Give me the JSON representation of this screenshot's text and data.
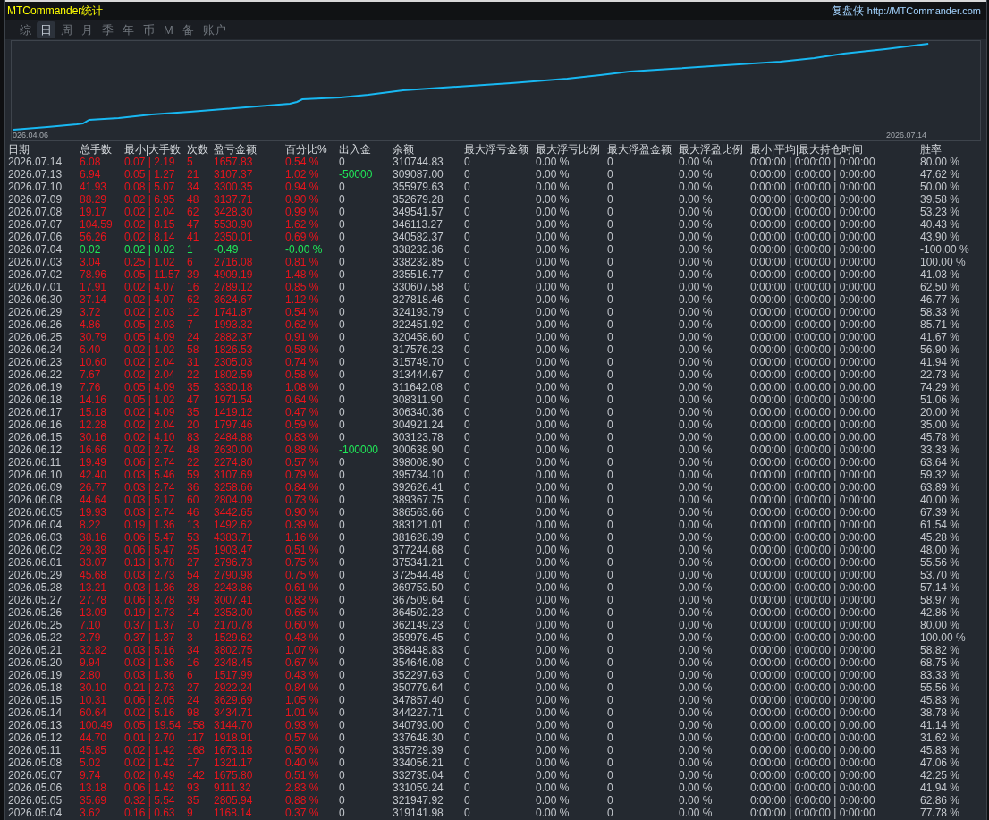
{
  "window": {
    "title": "MTCommander统计",
    "brand": "复盘侠",
    "url": "http://MTCommander.com"
  },
  "tabs": [
    {
      "label": "综",
      "selected": false
    },
    {
      "label": "日",
      "selected": true
    },
    {
      "label": "周",
      "selected": false
    },
    {
      "label": "月",
      "selected": false
    },
    {
      "label": "季",
      "selected": false
    },
    {
      "label": "年",
      "selected": false
    },
    {
      "label": "币",
      "selected": false
    },
    {
      "label": "M",
      "selected": false
    },
    {
      "label": "备",
      "selected": false
    },
    {
      "label": "账户",
      "selected": false
    }
  ],
  "chart": {
    "x_start_label": "026.04.06",
    "x_end_label": "2026.07.14"
  },
  "table": {
    "columns": [
      "日期",
      "总手数",
      "最小|大手数",
      "次数",
      "盈亏金额",
      "百分比%",
      "出入金",
      "余额",
      "最大浮亏金额",
      "最大浮亏比例",
      "最大浮盈金额",
      "最大浮盈比例",
      "最小|平均|最大持仓时间",
      "胜率"
    ],
    "rows": [
      {
        "cells": [
          "2026.07.14",
          "6.08",
          "0.07 | 2.19",
          "5",
          "1657.83",
          "0.54 %",
          "0",
          "310744.83",
          "0",
          "0.00 %",
          "0",
          "0.00 %",
          "0:00:00 | 0:00:00 | 0:00:00",
          "80.00 %"
        ],
        "color": "#e8141c",
        "transfer": {
          "color": "#c3c7cc"
        }
      },
      {
        "cells": [
          "2026.07.13",
          "6.94",
          "0.05 | 1.27",
          "21",
          "3107.37",
          "1.02 %",
          "-50000",
          "309087.00",
          "0",
          "0.00 %",
          "0",
          "0.00 %",
          "0:00:00 | 0:00:00 | 0:00:00",
          "47.62 %"
        ],
        "color": "#e8141c",
        "transfer": {
          "color": "#20e858"
        }
      },
      {
        "cells": [
          "2026.07.10",
          "41.93",
          "0.08 | 5.07",
          "34",
          "3300.35",
          "0.94 %",
          "0",
          "355979.63",
          "0",
          "0.00 %",
          "0",
          "0.00 %",
          "0:00:00 | 0:00:00 | 0:00:00",
          "50.00 %"
        ],
        "color": "#e8141c",
        "transfer": {
          "color": "#c3c7cc"
        }
      },
      {
        "cells": [
          "2026.07.09",
          "88.29",
          "0.02 | 6.95",
          "48",
          "3137.71",
          "0.90 %",
          "0",
          "352679.28",
          "0",
          "0.00 %",
          "0",
          "0.00 %",
          "0:00:00 | 0:00:00 | 0:00:00",
          "39.58 %"
        ],
        "color": "#e8141c",
        "transfer": {
          "color": "#c3c7cc"
        }
      },
      {
        "cells": [
          "2026.07.08",
          "19.17",
          "0.02 | 2.04",
          "62",
          "3428.30",
          "0.99 %",
          "0",
          "349541.57",
          "0",
          "0.00 %",
          "0",
          "0.00 %",
          "0:00:00 | 0:00:00 | 0:00:00",
          "53.23 %"
        ],
        "color": "#e8141c",
        "transfer": {
          "color": "#c3c7cc"
        }
      },
      {
        "cells": [
          "2026.07.07",
          "104.59",
          "0.02 | 8.15",
          "47",
          "5530.90",
          "1.62 %",
          "0",
          "346113.27",
          "0",
          "0.00 %",
          "0",
          "0.00 %",
          "0:00:00 | 0:00:00 | 0:00:00",
          "40.43 %"
        ],
        "color": "#e8141c",
        "transfer": {
          "color": "#c3c7cc"
        }
      },
      {
        "cells": [
          "2026.07.06",
          "56.26",
          "0.02 | 8.14",
          "41",
          "2350.01",
          "0.69 %",
          "0",
          "340582.37",
          "0",
          "0.00 %",
          "0",
          "0.00 %",
          "0:00:00 | 0:00:00 | 0:00:00",
          "43.90 %"
        ],
        "color": "#e8141c",
        "transfer": {
          "color": "#c3c7cc"
        }
      },
      {
        "cells": [
          "2026.07.04",
          "0.02",
          "0.02 | 0.02",
          "1",
          "-0.49",
          "-0.00 %",
          "0",
          "338232.36",
          "0",
          "0.00 %",
          "0",
          "0.00 %",
          "0:00:00 | 0:00:00 | 0:00:00",
          "-100.00 %"
        ],
        "color": "#20e858",
        "transfer": {
          "color": "#c3c7cc"
        }
      },
      {
        "cells": [
          "2026.07.03",
          "3.04",
          "0.25 | 1.02",
          "6",
          "2716.08",
          "0.81 %",
          "0",
          "338232.85",
          "0",
          "0.00 %",
          "0",
          "0.00 %",
          "0:00:00 | 0:00:00 | 0:00:00",
          "100.00 %"
        ],
        "color": "#e8141c",
        "transfer": {
          "color": "#c3c7cc"
        }
      },
      {
        "cells": [
          "2026.07.02",
          "78.96",
          "0.05 | 11.57",
          "39",
          "4909.19",
          "1.48 %",
          "0",
          "335516.77",
          "0",
          "0.00 %",
          "0",
          "0.00 %",
          "0:00:00 | 0:00:00 | 0:00:00",
          "41.03 %"
        ],
        "color": "#e8141c",
        "transfer": {
          "color": "#c3c7cc"
        }
      },
      {
        "cells": [
          "2026.07.01",
          "17.91",
          "0.02 | 4.07",
          "16",
          "2789.12",
          "0.85 %",
          "0",
          "330607.58",
          "0",
          "0.00 %",
          "0",
          "0.00 %",
          "0:00:00 | 0:00:00 | 0:00:00",
          "62.50 %"
        ],
        "color": "#e8141c",
        "transfer": {
          "color": "#c3c7cc"
        }
      },
      {
        "cells": [
          "2026.06.30",
          "37.14",
          "0.02 | 4.07",
          "62",
          "3624.67",
          "1.12 %",
          "0",
          "327818.46",
          "0",
          "0.00 %",
          "0",
          "0.00 %",
          "0:00:00 | 0:00:00 | 0:00:00",
          "46.77 %"
        ],
        "color": "#e8141c",
        "transfer": {
          "color": "#c3c7cc"
        }
      },
      {
        "cells": [
          "2026.06.29",
          "3.72",
          "0.02 | 2.03",
          "12",
          "1741.87",
          "0.54 %",
          "0",
          "324193.79",
          "0",
          "0.00 %",
          "0",
          "0.00 %",
          "0:00:00 | 0:00:00 | 0:00:00",
          "58.33 %"
        ],
        "color": "#e8141c",
        "transfer": {
          "color": "#c3c7cc"
        }
      },
      {
        "cells": [
          "2026.06.26",
          "4.86",
          "0.05 | 2.03",
          "7",
          "1993.32",
          "0.62 %",
          "0",
          "322451.92",
          "0",
          "0.00 %",
          "0",
          "0.00 %",
          "0:00:00 | 0:00:00 | 0:00:00",
          "85.71 %"
        ],
        "color": "#e8141c",
        "transfer": {
          "color": "#c3c7cc"
        }
      },
      {
        "cells": [
          "2026.06.25",
          "30.79",
          "0.05 | 4.09",
          "24",
          "2882.37",
          "0.91 %",
          "0",
          "320458.60",
          "0",
          "0.00 %",
          "0",
          "0.00 %",
          "0:00:00 | 0:00:00 | 0:00:00",
          "41.67 %"
        ],
        "color": "#e8141c",
        "transfer": {
          "color": "#c3c7cc"
        }
      },
      {
        "cells": [
          "2026.06.24",
          "6.40",
          "0.02 | 1.02",
          "58",
          "1826.53",
          "0.58 %",
          "0",
          "317576.23",
          "0",
          "0.00 %",
          "0",
          "0.00 %",
          "0:00:00 | 0:00:00 | 0:00:00",
          "56.90 %"
        ],
        "color": "#e8141c",
        "transfer": {
          "color": "#c3c7cc"
        }
      },
      {
        "cells": [
          "2026.06.23",
          "10.60",
          "0.02 | 2.04",
          "31",
          "2305.03",
          "0.74 %",
          "0",
          "315749.70",
          "0",
          "0.00 %",
          "0",
          "0.00 %",
          "0:00:00 | 0:00:00 | 0:00:00",
          "41.94 %"
        ],
        "color": "#e8141c",
        "transfer": {
          "color": "#c3c7cc"
        }
      },
      {
        "cells": [
          "2026.06.22",
          "7.67",
          "0.02 | 2.04",
          "22",
          "1802.59",
          "0.58 %",
          "0",
          "313444.67",
          "0",
          "0.00 %",
          "0",
          "0.00 %",
          "0:00:00 | 0:00:00 | 0:00:00",
          "22.73 %"
        ],
        "color": "#e8141c",
        "transfer": {
          "color": "#c3c7cc"
        }
      },
      {
        "cells": [
          "2026.06.19",
          "7.76",
          "0.05 | 4.09",
          "35",
          "3330.18",
          "1.08 %",
          "0",
          "311642.08",
          "0",
          "0.00 %",
          "0",
          "0.00 %",
          "0:00:00 | 0:00:00 | 0:00:00",
          "74.29 %"
        ],
        "color": "#e8141c",
        "transfer": {
          "color": "#c3c7cc"
        }
      },
      {
        "cells": [
          "2026.06.18",
          "14.16",
          "0.05 | 1.02",
          "47",
          "1971.54",
          "0.64 %",
          "0",
          "308311.90",
          "0",
          "0.00 %",
          "0",
          "0.00 %",
          "0:00:00 | 0:00:00 | 0:00:00",
          "51.06 %"
        ],
        "color": "#e8141c",
        "transfer": {
          "color": "#c3c7cc"
        }
      },
      {
        "cells": [
          "2026.06.17",
          "15.18",
          "0.02 | 4.09",
          "35",
          "1419.12",
          "0.47 %",
          "0",
          "306340.36",
          "0",
          "0.00 %",
          "0",
          "0.00 %",
          "0:00:00 | 0:00:00 | 0:00:00",
          "20.00 %"
        ],
        "color": "#e8141c",
        "transfer": {
          "color": "#c3c7cc"
        }
      },
      {
        "cells": [
          "2026.06.16",
          "12.28",
          "0.02 | 2.04",
          "20",
          "1797.46",
          "0.59 %",
          "0",
          "304921.24",
          "0",
          "0.00 %",
          "0",
          "0.00 %",
          "0:00:00 | 0:00:00 | 0:00:00",
          "35.00 %"
        ],
        "color": "#e8141c",
        "transfer": {
          "color": "#c3c7cc"
        }
      },
      {
        "cells": [
          "2026.06.15",
          "30.16",
          "0.02 | 4.10",
          "83",
          "2484.88",
          "0.83 %",
          "0",
          "303123.78",
          "0",
          "0.00 %",
          "0",
          "0.00 %",
          "0:00:00 | 0:00:00 | 0:00:00",
          "45.78 %"
        ],
        "color": "#e8141c",
        "transfer": {
          "color": "#c3c7cc"
        }
      },
      {
        "cells": [
          "2026.06.12",
          "16.66",
          "0.02 | 2.74",
          "48",
          "2630.00",
          "0.88 %",
          "-100000",
          "300638.90",
          "0",
          "0.00 %",
          "0",
          "0.00 %",
          "0:00:00 | 0:00:00 | 0:00:00",
          "33.33 %"
        ],
        "color": "#e8141c",
        "transfer": {
          "color": "#20e858"
        }
      },
      {
        "cells": [
          "2026.06.11",
          "19.49",
          "0.06 | 2.74",
          "22",
          "2274.80",
          "0.57 %",
          "0",
          "398008.90",
          "0",
          "0.00 %",
          "0",
          "0.00 %",
          "0:00:00 | 0:00:00 | 0:00:00",
          "63.64 %"
        ],
        "color": "#e8141c",
        "transfer": {
          "color": "#c3c7cc"
        }
      },
      {
        "cells": [
          "2026.06.10",
          "42.40",
          "0.03 | 5.46",
          "59",
          "3107.69",
          "0.79 %",
          "0",
          "395734.10",
          "0",
          "0.00 %",
          "0",
          "0.00 %",
          "0:00:00 | 0:00:00 | 0:00:00",
          "59.32 %"
        ],
        "color": "#e8141c",
        "transfer": {
          "color": "#c3c7cc"
        }
      },
      {
        "cells": [
          "2026.06.09",
          "26.77",
          "0.03 | 2.74",
          "36",
          "3258.66",
          "0.84 %",
          "0",
          "392626.41",
          "0",
          "0.00 %",
          "0",
          "0.00 %",
          "0:00:00 | 0:00:00 | 0:00:00",
          "63.89 %"
        ],
        "color": "#e8141c",
        "transfer": {
          "color": "#c3c7cc"
        }
      },
      {
        "cells": [
          "2026.06.08",
          "44.64",
          "0.03 | 5.17",
          "60",
          "2804.09",
          "0.73 %",
          "0",
          "389367.75",
          "0",
          "0.00 %",
          "0",
          "0.00 %",
          "0:00:00 | 0:00:00 | 0:00:00",
          "40.00 %"
        ],
        "color": "#e8141c",
        "transfer": {
          "color": "#c3c7cc"
        }
      },
      {
        "cells": [
          "2026.06.05",
          "19.93",
          "0.03 | 2.74",
          "46",
          "3442.65",
          "0.90 %",
          "0",
          "386563.66",
          "0",
          "0.00 %",
          "0",
          "0.00 %",
          "0:00:00 | 0:00:00 | 0:00:00",
          "67.39 %"
        ],
        "color": "#e8141c",
        "transfer": {
          "color": "#c3c7cc"
        }
      },
      {
        "cells": [
          "2026.06.04",
          "8.22",
          "0.19 | 1.36",
          "13",
          "1492.62",
          "0.39 %",
          "0",
          "383121.01",
          "0",
          "0.00 %",
          "0",
          "0.00 %",
          "0:00:00 | 0:00:00 | 0:00:00",
          "61.54 %"
        ],
        "color": "#e8141c",
        "transfer": {
          "color": "#c3c7cc"
        }
      },
      {
        "cells": [
          "2026.06.03",
          "38.16",
          "0.06 | 5.47",
          "53",
          "4383.71",
          "1.16 %",
          "0",
          "381628.39",
          "0",
          "0.00 %",
          "0",
          "0.00 %",
          "0:00:00 | 0:00:00 | 0:00:00",
          "45.28 %"
        ],
        "color": "#e8141c",
        "transfer": {
          "color": "#c3c7cc"
        }
      },
      {
        "cells": [
          "2026.06.02",
          "29.38",
          "0.06 | 5.47",
          "25",
          "1903.47",
          "0.51 %",
          "0",
          "377244.68",
          "0",
          "0.00 %",
          "0",
          "0.00 %",
          "0:00:00 | 0:00:00 | 0:00:00",
          "48.00 %"
        ],
        "color": "#e8141c",
        "transfer": {
          "color": "#c3c7cc"
        }
      },
      {
        "cells": [
          "2026.06.01",
          "33.07",
          "0.13 | 3.78",
          "27",
          "2796.73",
          "0.75 %",
          "0",
          "375341.21",
          "0",
          "0.00 %",
          "0",
          "0.00 %",
          "0:00:00 | 0:00:00 | 0:00:00",
          "55.56 %"
        ],
        "color": "#e8141c",
        "transfer": {
          "color": "#c3c7cc"
        }
      },
      {
        "cells": [
          "2026.05.29",
          "45.68",
          "0.03 | 2.73",
          "54",
          "2790.98",
          "0.75 %",
          "0",
          "372544.48",
          "0",
          "0.00 %",
          "0",
          "0.00 %",
          "0:00:00 | 0:00:00 | 0:00:00",
          "53.70 %"
        ],
        "color": "#e8141c",
        "transfer": {
          "color": "#c3c7cc"
        }
      },
      {
        "cells": [
          "2026.05.28",
          "13.21",
          "0.03 | 1.36",
          "28",
          "2243.86",
          "0.61 %",
          "0",
          "369753.50",
          "0",
          "0.00 %",
          "0",
          "0.00 %",
          "0:00:00 | 0:00:00 | 0:00:00",
          "57.14 %"
        ],
        "color": "#e8141c",
        "transfer": {
          "color": "#c3c7cc"
        }
      },
      {
        "cells": [
          "2026.05.27",
          "27.78",
          "0.06 | 3.78",
          "39",
          "3007.41",
          "0.83 %",
          "0",
          "367509.64",
          "0",
          "0.00 %",
          "0",
          "0.00 %",
          "0:00:00 | 0:00:00 | 0:00:00",
          "58.97 %"
        ],
        "color": "#e8141c",
        "transfer": {
          "color": "#c3c7cc"
        }
      },
      {
        "cells": [
          "2026.05.26",
          "13.09",
          "0.19 | 2.73",
          "14",
          "2353.00",
          "0.65 %",
          "0",
          "364502.23",
          "0",
          "0.00 %",
          "0",
          "0.00 %",
          "0:00:00 | 0:00:00 | 0:00:00",
          "42.86 %"
        ],
        "color": "#e8141c",
        "transfer": {
          "color": "#c3c7cc"
        }
      },
      {
        "cells": [
          "2026.05.25",
          "7.10",
          "0.37 | 1.37",
          "10",
          "2170.78",
          "0.60 %",
          "0",
          "362149.23",
          "0",
          "0.00 %",
          "0",
          "0.00 %",
          "0:00:00 | 0:00:00 | 0:00:00",
          "80.00 %"
        ],
        "color": "#e8141c",
        "transfer": {
          "color": "#c3c7cc"
        }
      },
      {
        "cells": [
          "2026.05.22",
          "2.79",
          "0.37 | 1.37",
          "3",
          "1529.62",
          "0.43 %",
          "0",
          "359978.45",
          "0",
          "0.00 %",
          "0",
          "0.00 %",
          "0:00:00 | 0:00:00 | 0:00:00",
          "100.00 %"
        ],
        "color": "#e8141c",
        "transfer": {
          "color": "#c3c7cc"
        }
      },
      {
        "cells": [
          "2026.05.21",
          "32.82",
          "0.03 | 5.16",
          "34",
          "3802.75",
          "1.07 %",
          "0",
          "358448.83",
          "0",
          "0.00 %",
          "0",
          "0.00 %",
          "0:00:00 | 0:00:00 | 0:00:00",
          "58.82 %"
        ],
        "color": "#e8141c",
        "transfer": {
          "color": "#c3c7cc"
        }
      },
      {
        "cells": [
          "2026.05.20",
          "9.94",
          "0.03 | 1.36",
          "16",
          "2348.45",
          "0.67 %",
          "0",
          "354646.08",
          "0",
          "0.00 %",
          "0",
          "0.00 %",
          "0:00:00 | 0:00:00 | 0:00:00",
          "68.75 %"
        ],
        "color": "#e8141c",
        "transfer": {
          "color": "#c3c7cc"
        }
      },
      {
        "cells": [
          "2026.05.19",
          "2.80",
          "0.03 | 1.36",
          "6",
          "1517.99",
          "0.43 %",
          "0",
          "352297.63",
          "0",
          "0.00 %",
          "0",
          "0.00 %",
          "0:00:00 | 0:00:00 | 0:00:00",
          "83.33 %"
        ],
        "color": "#e8141c",
        "transfer": {
          "color": "#c3c7cc"
        }
      },
      {
        "cells": [
          "2026.05.18",
          "30.10",
          "0.21 | 2.73",
          "27",
          "2922.24",
          "0.84 %",
          "0",
          "350779.64",
          "0",
          "0.00 %",
          "0",
          "0.00 %",
          "0:00:00 | 0:00:00 | 0:00:00",
          "55.56 %"
        ],
        "color": "#e8141c",
        "transfer": {
          "color": "#c3c7cc"
        }
      },
      {
        "cells": [
          "2026.05.15",
          "10.31",
          "0.06 | 2.05",
          "24",
          "3629.69",
          "1.05 %",
          "0",
          "347857.40",
          "0",
          "0.00 %",
          "0",
          "0.00 %",
          "0:00:00 | 0:00:00 | 0:00:00",
          "45.83 %"
        ],
        "color": "#e8141c",
        "transfer": {
          "color": "#c3c7cc"
        }
      },
      {
        "cells": [
          "2026.05.14",
          "60.64",
          "0.02 | 5.16",
          "98",
          "3434.71",
          "1.01 %",
          "0",
          "344227.71",
          "0",
          "0.00 %",
          "0",
          "0.00 %",
          "0:00:00 | 0:00:00 | 0:00:00",
          "38.78 %"
        ],
        "color": "#e8141c",
        "transfer": {
          "color": "#c3c7cc"
        }
      },
      {
        "cells": [
          "2026.05.13",
          "100.49",
          "0.05 | 19.54",
          "158",
          "3144.70",
          "0.93 %",
          "0",
          "340793.00",
          "0",
          "0.00 %",
          "0",
          "0.00 %",
          "0:00:00 | 0:00:00 | 0:00:00",
          "41.14 %"
        ],
        "color": "#e8141c",
        "transfer": {
          "color": "#c3c7cc"
        }
      },
      {
        "cells": [
          "2026.05.12",
          "44.70",
          "0.01 | 2.70",
          "117",
          "1918.91",
          "0.57 %",
          "0",
          "337648.30",
          "0",
          "0.00 %",
          "0",
          "0.00 %",
          "0:00:00 | 0:00:00 | 0:00:00",
          "31.62 %"
        ],
        "color": "#e8141c",
        "transfer": {
          "color": "#c3c7cc"
        }
      },
      {
        "cells": [
          "2026.05.11",
          "45.85",
          "0.02 | 1.42",
          "168",
          "1673.18",
          "0.50 %",
          "0",
          "335729.39",
          "0",
          "0.00 %",
          "0",
          "0.00 %",
          "0:00:00 | 0:00:00 | 0:00:00",
          "45.83 %"
        ],
        "color": "#e8141c",
        "transfer": {
          "color": "#c3c7cc"
        }
      },
      {
        "cells": [
          "2026.05.08",
          "5.02",
          "0.02 | 1.42",
          "17",
          "1321.17",
          "0.40 %",
          "0",
          "334056.21",
          "0",
          "0.00 %",
          "0",
          "0.00 %",
          "0:00:00 | 0:00:00 | 0:00:00",
          "47.06 %"
        ],
        "color": "#e8141c",
        "transfer": {
          "color": "#c3c7cc"
        }
      },
      {
        "cells": [
          "2026.05.07",
          "9.74",
          "0.02 | 0.49",
          "142",
          "1675.80",
          "0.51 %",
          "0",
          "332735.04",
          "0",
          "0.00 %",
          "0",
          "0.00 %",
          "0:00:00 | 0:00:00 | 0:00:00",
          "42.25 %"
        ],
        "color": "#e8141c",
        "transfer": {
          "color": "#c3c7cc"
        }
      },
      {
        "cells": [
          "2026.05.06",
          "13.18",
          "0.06 | 1.42",
          "93",
          "9111.32",
          "2.83 %",
          "0",
          "331059.24",
          "0",
          "0.00 %",
          "0",
          "0.00 %",
          "0:00:00 | 0:00:00 | 0:00:00",
          "41.94 %"
        ],
        "color": "#e8141c",
        "transfer": {
          "color": "#c3c7cc"
        }
      },
      {
        "cells": [
          "2026.05.05",
          "35.69",
          "0.32 | 5.54",
          "35",
          "2805.94",
          "0.88 %",
          "0",
          "321947.92",
          "0",
          "0.00 %",
          "0",
          "0.00 %",
          "0:00:00 | 0:00:00 | 0:00:00",
          "62.86 %"
        ],
        "color": "#e8141c",
        "transfer": {
          "color": "#c3c7cc"
        }
      },
      {
        "cells": [
          "2026.05.04",
          "3.62",
          "0.16 | 0.63",
          "9",
          "1168.14",
          "0.37 %",
          "0",
          "319141.98",
          "0",
          "0.00 %",
          "0",
          "0.00 %",
          "0:00:00 | 0:00:00 | 0:00:00",
          "77.78 %"
        ],
        "color": "#e8141c",
        "transfer": {
          "color": "#c3c7cc"
        }
      }
    ]
  }
}
